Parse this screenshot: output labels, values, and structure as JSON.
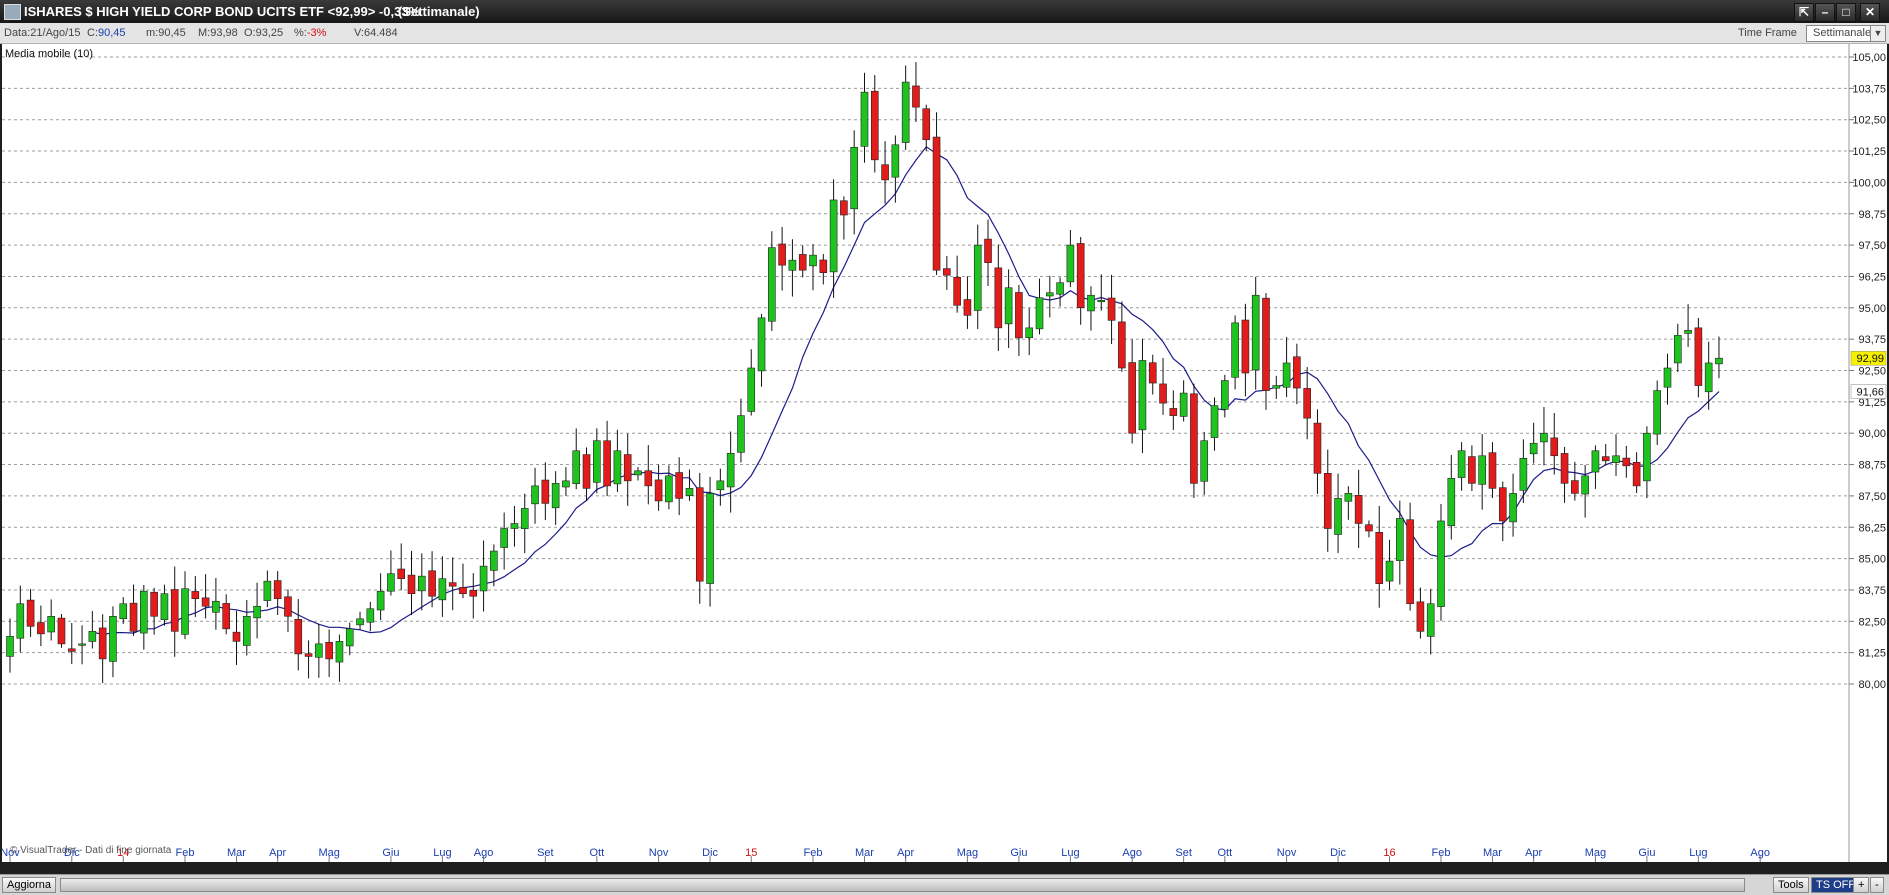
{
  "window": {
    "title": "ISHARES $ HIGH YIELD CORP BOND UCITS ETF <92,99> -0,33%",
    "timeframe_label": "(Settimanale)"
  },
  "info": {
    "date": "Data:21/Ago/15",
    "close_label": "C:",
    "close": "90,45",
    "min_label": "m:",
    "min": "90,45",
    "max_label": "M:",
    "max": "93,98",
    "open_label": "O:",
    "open": "93,25",
    "pct_label": "%:",
    "pct": "-3%",
    "volume_label": "V:",
    "volume": "64.484",
    "time_frame_label": "Time Frame",
    "time_frame_value": "Settimanale"
  },
  "indicator": {
    "label": "Media mobile (10)"
  },
  "footer": {
    "watermark": "© VisualTrader - Dati di fine giornata"
  },
  "statusbar": {
    "refresh": "Aggiorna",
    "tools": "Tools",
    "ts_off": "TS OFF",
    "plus": "+",
    "minus": "-"
  },
  "colors": {
    "up": "#1fc31f",
    "down": "#e21b1b",
    "ma": "#1c1c8c",
    "price_tag": "#f4f000"
  },
  "chart_data": {
    "type": "candlestick",
    "y_ticks": [
      "80,00",
      "81,25",
      "82,50",
      "83,75",
      "85,00",
      "86,25",
      "87,50",
      "88,75",
      "90,00",
      "91,25",
      "92,50",
      "93,75",
      "95,00",
      "96,25",
      "97,50",
      "98,75",
      "100,00",
      "101,25",
      "102,50",
      "103,75",
      "105,00"
    ],
    "ylim": [
      79.0,
      106.0
    ],
    "x_labels": [
      {
        "label": "Nov",
        "i": 0,
        "red": false
      },
      {
        "label": "Dic",
        "i": 6,
        "red": false
      },
      {
        "label": "14",
        "i": 11,
        "red": true
      },
      {
        "label": "Feb",
        "i": 17,
        "red": false
      },
      {
        "label": "Mar",
        "i": 22,
        "red": false
      },
      {
        "label": "Apr",
        "i": 26,
        "red": false
      },
      {
        "label": "Mag",
        "i": 31,
        "red": false
      },
      {
        "label": "Giu",
        "i": 37,
        "red": false
      },
      {
        "label": "Lug",
        "i": 42,
        "red": false
      },
      {
        "label": "Ago",
        "i": 46,
        "red": false
      },
      {
        "label": "Set",
        "i": 52,
        "red": false
      },
      {
        "label": "Ott",
        "i": 57,
        "red": false
      },
      {
        "label": "Nov",
        "i": 63,
        "red": false
      },
      {
        "label": "Dic",
        "i": 68,
        "red": false
      },
      {
        "label": "15",
        "i": 72,
        "red": true
      },
      {
        "label": "Feb",
        "i": 78,
        "red": false
      },
      {
        "label": "Mar",
        "i": 83,
        "red": false
      },
      {
        "label": "Apr",
        "i": 87,
        "red": false
      },
      {
        "label": "Mag",
        "i": 93,
        "red": false
      },
      {
        "label": "Giu",
        "i": 98,
        "red": false
      },
      {
        "label": "Lug",
        "i": 103,
        "red": false
      },
      {
        "label": "Ago",
        "i": 109,
        "red": false
      },
      {
        "label": "Set",
        "i": 114,
        "red": false
      },
      {
        "label": "Ott",
        "i": 118,
        "red": false
      },
      {
        "label": "Nov",
        "i": 124,
        "red": false
      },
      {
        "label": "Dic",
        "i": 129,
        "red": false
      },
      {
        "label": "16",
        "i": 134,
        "red": true
      },
      {
        "label": "Feb",
        "i": 139,
        "red": false
      },
      {
        "label": "Mar",
        "i": 144,
        "red": false
      },
      {
        "label": "Apr",
        "i": 148,
        "red": false
      },
      {
        "label": "Mag",
        "i": 154,
        "red": false
      },
      {
        "label": "Giu",
        "i": 159,
        "red": false
      },
      {
        "label": "Lug",
        "i": 164,
        "red": false
      },
      {
        "label": "Ago",
        "i": 170,
        "red": false
      }
    ],
    "closes": [
      81.9,
      83.2,
      82.3,
      82.0,
      82.7,
      81.6,
      81.3,
      81.6,
      82.1,
      81.0,
      82.7,
      83.2,
      82.1,
      83.7,
      82.7,
      83.6,
      82.1,
      83.8,
      83.4,
      83.1,
      83.3,
      82.2,
      81.7,
      82.7,
      83.1,
      84.1,
      83.4,
      82.7,
      81.2,
      81.1,
      81.6,
      81.0,
      81.7,
      82.2,
      82.6,
      83.0,
      83.7,
      84.4,
      84.2,
      83.6,
      84.3,
      83.5,
      84.2,
      83.9,
      83.6,
      83.5,
      84.7,
      85.3,
      86.2,
      86.4,
      87.0,
      87.9,
      87.2,
      88.0,
      88.1,
      89.3,
      87.8,
      89.7,
      87.9,
      89.3,
      88.1,
      88.5,
      87.9,
      87.3,
      88.3,
      87.4,
      87.8,
      84.1,
      87.6,
      88.1,
      89.2,
      90.7,
      92.6,
      94.6,
      97.4,
      96.7,
      96.9,
      96.5,
      97.1,
      96.4,
      99.3,
      98.7,
      101.4,
      103.6,
      100.9,
      100.1,
      101.5,
      104.0,
      103.0,
      101.7,
      96.5,
      96.3,
      95.1,
      94.7,
      97.5,
      96.8,
      94.2,
      95.8,
      93.8,
      94.2,
      95.4,
      95.6,
      96.0,
      97.5,
      95.0,
      95.5,
      95.3,
      94.5,
      92.6,
      90.0,
      92.9,
      92.0,
      91.2,
      90.7,
      91.6,
      88.0,
      89.7,
      91.1,
      92.1,
      94.4,
      92.4,
      95.5,
      91.7,
      91.9,
      92.8,
      91.8,
      90.6,
      88.4,
      86.2,
      87.4,
      87.6,
      86.4,
      86.1,
      84.0,
      84.9,
      86.6,
      83.2,
      82.1,
      83.2,
      86.5,
      88.2,
      89.3,
      88.0,
      89.1,
      87.8,
      86.5,
      87.6,
      89.0,
      89.6,
      90.0,
      89.1,
      88.0,
      87.6,
      88.3,
      89.3,
      88.9,
      89.1,
      88.7,
      87.9,
      90.0,
      91.7,
      92.6,
      93.9,
      94.1,
      91.9,
      92.8,
      92.99
    ],
    "ma10_visible_from": 8
  }
}
